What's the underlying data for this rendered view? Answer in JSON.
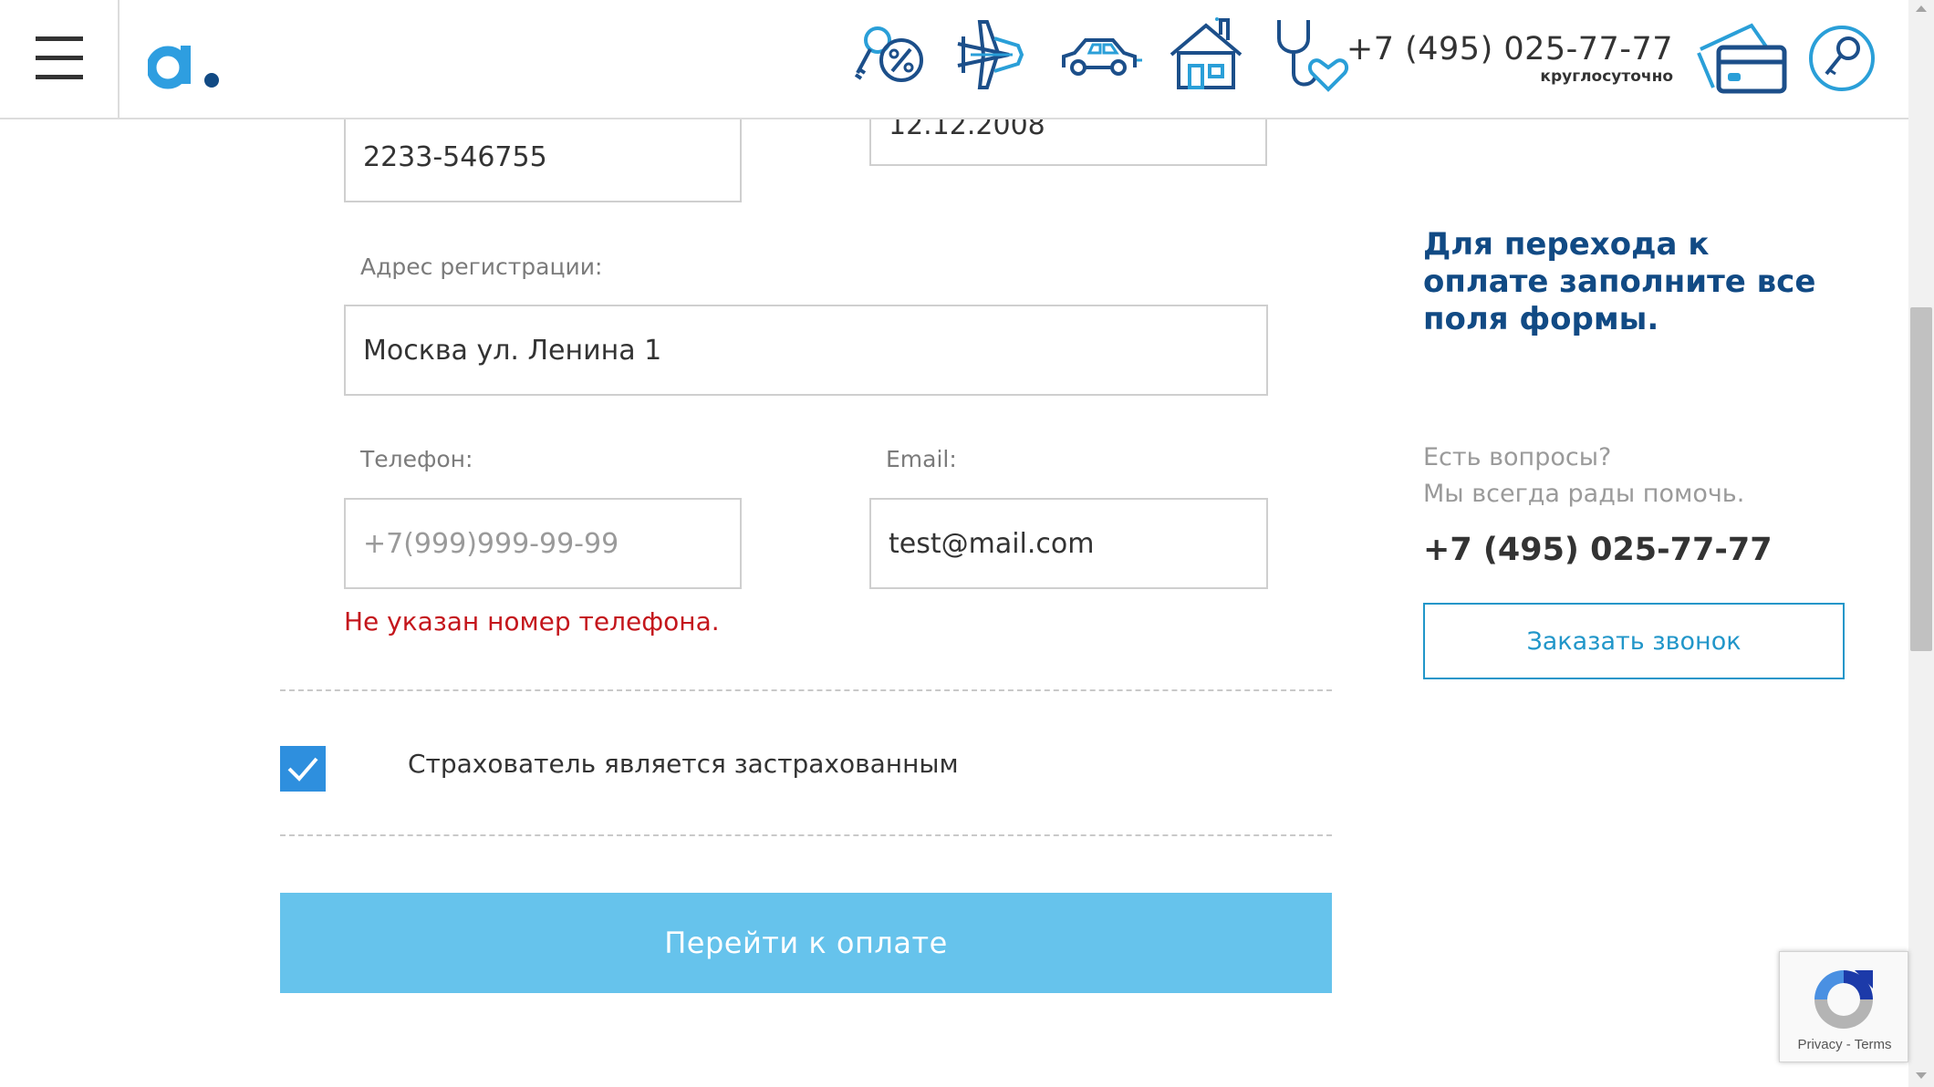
{
  "header": {
    "logo_text": "a.",
    "phone": "+7 (495) 025-77-77",
    "phone_note": "круглосуточно",
    "nav_icons": [
      "key-percent-icon",
      "plane-icon",
      "car-icon",
      "house-icon",
      "stethoscope-heart-icon"
    ],
    "accent_color": "#1a95d4",
    "dark_color": "#114a84"
  },
  "form": {
    "passport_value": "2233-546755",
    "date_value": "12.12.2008",
    "address_label": "Адрес регистрации:",
    "address_value": "Москва ул. Ленина 1",
    "phone_label": "Телефон:",
    "phone_placeholder": "+7(999)999-99-99",
    "email_label": "Email:",
    "email_value": "test@mail.com",
    "phone_error": "Не указан номер телефона.",
    "insured_checkbox_label": "Страхователь является застрахованным",
    "insured_checked": true,
    "pay_button": "Перейти к оплате"
  },
  "sidebar": {
    "notice": "Для перехода к оплате заполните все поля формы.",
    "questions_line1": "Есть вопросы?",
    "questions_line2": "Мы всегда рады помочь.",
    "phone": "+7 (495) 025-77-77",
    "callback_button": "Заказать звонок"
  },
  "recaptcha": {
    "privacy": "Privacy",
    "separator": " - ",
    "terms": "Terms"
  }
}
